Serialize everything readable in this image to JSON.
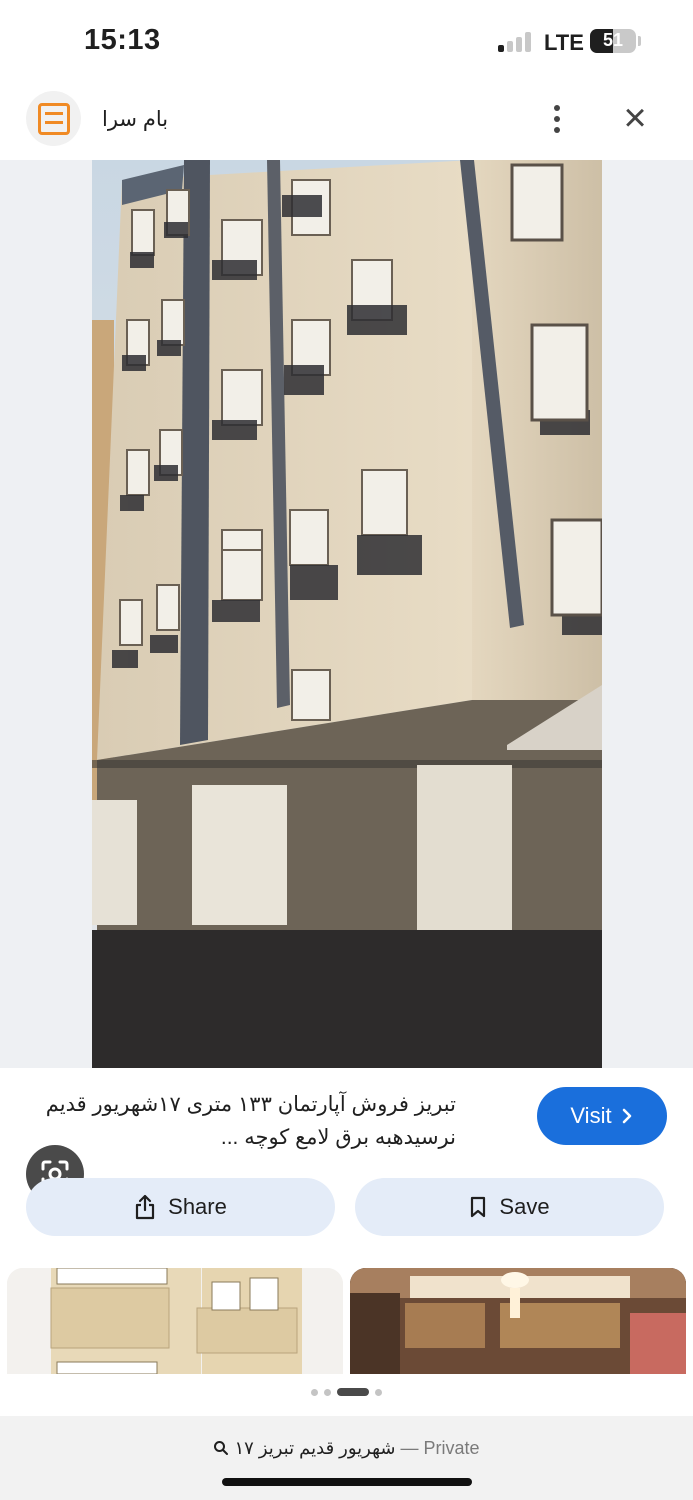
{
  "status_bar": {
    "time": "15:13",
    "network": "LTE",
    "battery": "51"
  },
  "header": {
    "site_name": "بام سرا",
    "logo_icon": "bamsara-logo",
    "menu_icon": "more-vert-icon",
    "close_icon": "close-icon"
  },
  "result": {
    "title_line1": "تبریز فروش آپارتمان ۱۳۳ متری ۱۷شهریور قدیم",
    "title_line2": "نرسیدهبه برق لامع کوچه ...",
    "visit_label": "Visit",
    "visit_color": "#1a6fdc"
  },
  "actions": {
    "share_label": "Share",
    "save_label": "Save"
  },
  "carousel": {
    "dot_count": 4,
    "active_index": 2
  },
  "bottom_bar": {
    "query": "۱۷ شهریور قدیم تبریز",
    "separator": "—",
    "mode": "Private"
  }
}
